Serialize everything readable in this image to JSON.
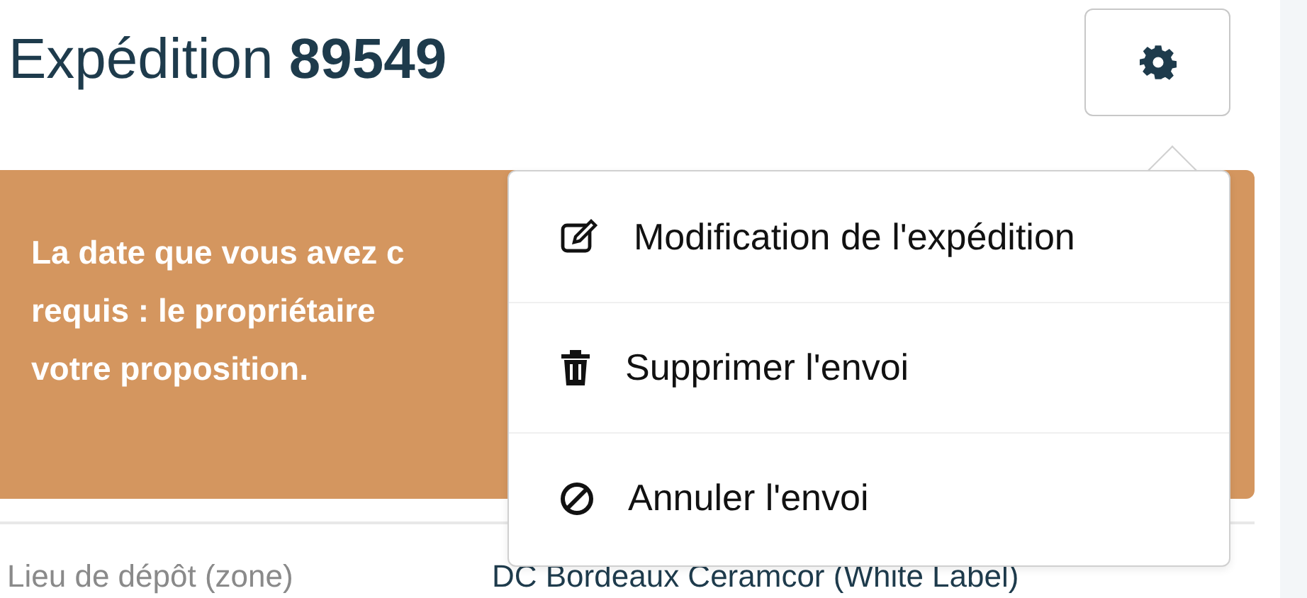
{
  "header": {
    "title": "Expédition",
    "number": "89549"
  },
  "alert": {
    "lines": [
      "La date que vous avez c",
      "requis : le propriétaire",
      "votre proposition."
    ]
  },
  "menu": {
    "expanded": true,
    "items": [
      {
        "kind": "edit",
        "label": "Modification de l'expédition"
      },
      {
        "kind": "delete",
        "label": "Supprimer l'envoi"
      },
      {
        "kind": "cancel",
        "label": "Annuler l'envoi"
      }
    ]
  },
  "details": [
    {
      "label": "Lieu de dépôt (zone)",
      "value": "DC Bordeaux Ceramcor (White Label)"
    }
  ]
}
